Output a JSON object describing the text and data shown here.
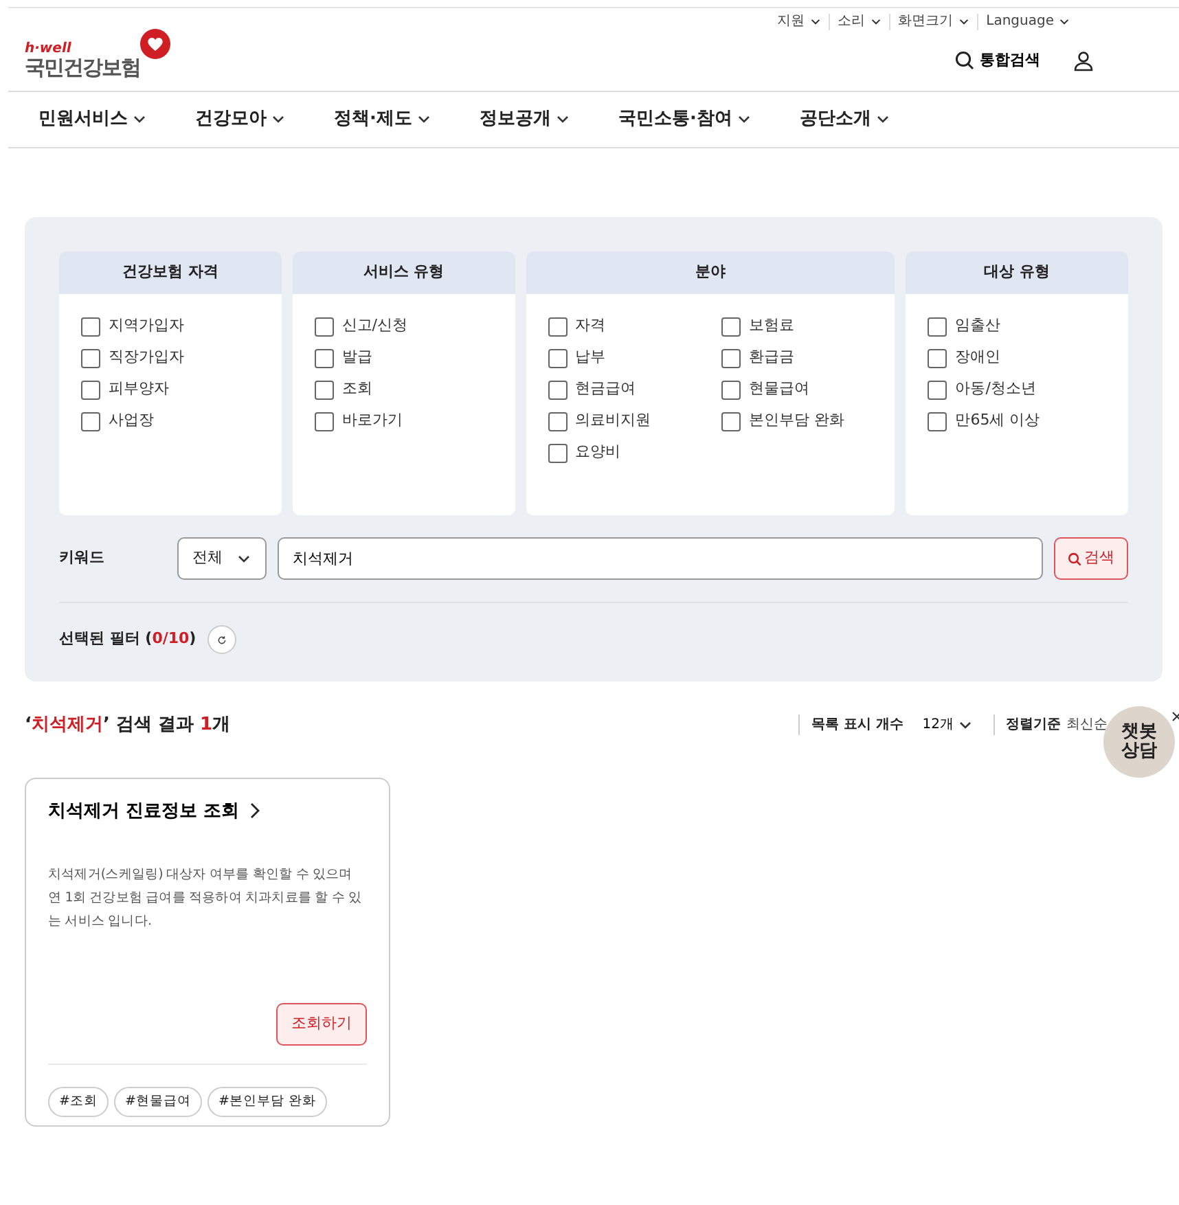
{
  "utility_links": [
    {
      "label": "지원"
    },
    {
      "label": "소리"
    },
    {
      "label": "화면크기"
    },
    {
      "label": "Language"
    }
  ],
  "logo": {
    "tagline": "h·well",
    "name": "국민건강보험"
  },
  "header_search": "통합검색",
  "nav": [
    "민원서비스",
    "건강모아",
    "정책·제도",
    "정보공개",
    "국민소통·참여",
    "공단소개"
  ],
  "filter_groups": [
    {
      "title": "건강보험 자격",
      "options": [
        {
          "label": "지역가입자",
          "checked": false
        },
        {
          "label": "직장가입자",
          "checked": false
        },
        {
          "label": "피부양자",
          "checked": false
        },
        {
          "label": "사업장",
          "checked": false
        }
      ]
    },
    {
      "title": "서비스 유형",
      "options": [
        {
          "label": "신고/신청",
          "checked": false
        },
        {
          "label": "발급",
          "checked": false
        },
        {
          "label": "조회",
          "checked": false
        },
        {
          "label": "바로가기",
          "checked": false
        }
      ]
    },
    {
      "title": "분야",
      "options": [
        {
          "label": "자격",
          "checked": false
        },
        {
          "label": "보험료",
          "checked": false
        },
        {
          "label": "납부",
          "checked": false
        },
        {
          "label": "환급금",
          "checked": false
        },
        {
          "label": "현금급여",
          "checked": false
        },
        {
          "label": "현물급여",
          "checked": false
        },
        {
          "label": "의료비지원",
          "checked": false
        },
        {
          "label": "본인부담 완화",
          "checked": false
        },
        {
          "label": "요양비",
          "checked": false
        }
      ]
    },
    {
      "title": "대상 유형",
      "options": [
        {
          "label": "임출산",
          "checked": false
        },
        {
          "label": "장애인",
          "checked": false
        },
        {
          "label": "아동/청소년",
          "checked": false
        },
        {
          "label": "만65세 이상",
          "checked": false
        }
      ]
    }
  ],
  "keyword": {
    "label": "키워드",
    "scope": "전체",
    "value": "치석제거",
    "button": "검색"
  },
  "selected_filters": {
    "label": "선택된 필터 (**0/10**)"
  },
  "results": {
    "heading": "‘**치석제거**’ 검색 결과 **1**개",
    "page_size_label": "목록 표시 개수",
    "page_size": "12개",
    "sort_label": "정렬기준",
    "sort": "최신순"
  },
  "chatbot": {
    "label": "챗봇 상담"
  },
  "cards": [
    {
      "title": "치석제거 진료정보 조회",
      "description": "치석제거(스케일링) 대상자 여부를 확인할 수 있으며 연 1회 건강보험 급여를 적용하여 치과치료를 할 수 있는 서비스 입니다.",
      "button": "조회하기",
      "tags": [
        "#조회",
        "#현물급여",
        "#본인부담 완화"
      ]
    }
  ]
}
